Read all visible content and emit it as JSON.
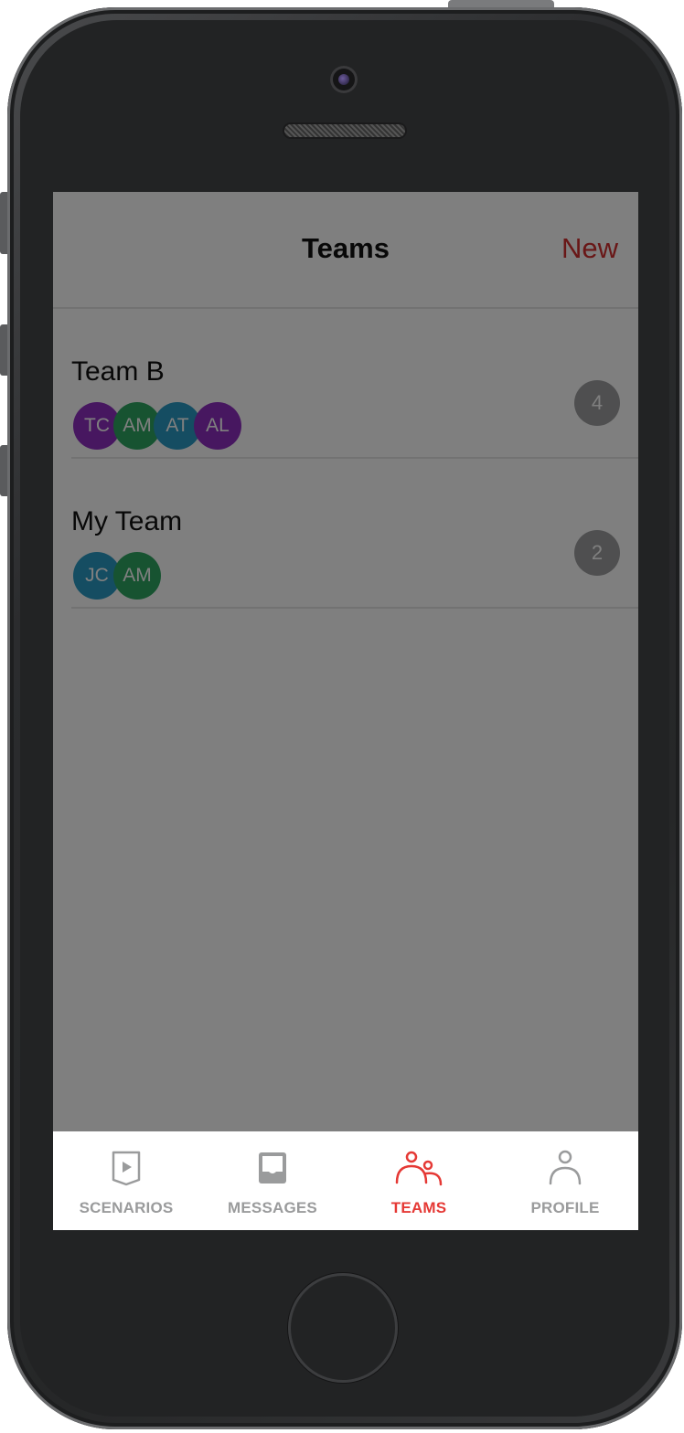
{
  "header": {
    "title": "Teams",
    "new_label": "New"
  },
  "teams": [
    {
      "name": "Team B",
      "count": "4",
      "members": [
        {
          "initials": "TC",
          "color": "#8e2fc0"
        },
        {
          "initials": "AM",
          "color": "#2fa663"
        },
        {
          "initials": "AT",
          "color": "#2a9ac4"
        },
        {
          "initials": "AL",
          "color": "#8e2fc0"
        }
      ]
    },
    {
      "name": "My Team",
      "count": "2",
      "members": [
        {
          "initials": "JC",
          "color": "#2a9ac4"
        },
        {
          "initials": "AM",
          "color": "#2fa663"
        }
      ]
    }
  ],
  "tabbar": {
    "tabs": [
      {
        "label": "SCENARIOS",
        "icon": "scenarios-play-icon",
        "active": false
      },
      {
        "label": "MESSAGES",
        "icon": "inbox-icon",
        "active": false
      },
      {
        "label": "TEAMS",
        "icon": "team-icon",
        "active": true
      },
      {
        "label": "PROFILE",
        "icon": "person-icon",
        "active": false
      }
    ]
  },
  "colors": {
    "accent": "#e53935",
    "new_link": "#d32f2f",
    "badge": "#9e9fa0",
    "overlay": "rgba(0,0,0,0.5)"
  }
}
